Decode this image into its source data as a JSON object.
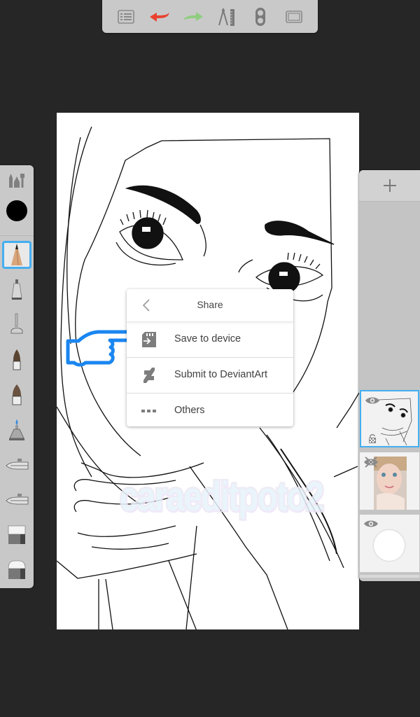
{
  "toolbar": {
    "buttons": [
      {
        "name": "layers-list",
        "icon": "list-icon"
      },
      {
        "name": "undo",
        "icon": "undo-arrow-icon",
        "color": "#e8432f"
      },
      {
        "name": "redo",
        "icon": "redo-arrow-icon",
        "color": "#8fcd7f"
      },
      {
        "name": "guides",
        "icon": "compass-ruler-icon"
      },
      {
        "name": "symmetry",
        "icon": "symmetry-icon"
      },
      {
        "name": "fullscreen",
        "icon": "fullscreen-icon"
      }
    ]
  },
  "palette": {
    "current_color": "#000000",
    "selected_accent": "#45aef0",
    "tools": [
      {
        "name": "pencil",
        "selected": true
      },
      {
        "name": "ballpoint-pen",
        "selected": false
      },
      {
        "name": "marker",
        "selected": false
      },
      {
        "name": "brush",
        "selected": false
      },
      {
        "name": "paint-brush",
        "selected": false
      },
      {
        "name": "fill-marker",
        "selected": false
      },
      {
        "name": "airbrush",
        "selected": false
      },
      {
        "name": "airbrush-alt",
        "selected": false
      },
      {
        "name": "hard-eraser",
        "selected": false
      },
      {
        "name": "soft-eraser",
        "selected": false
      }
    ]
  },
  "canvas": {
    "watermark": "caraeditpoto2"
  },
  "share_menu": {
    "title": "Share",
    "items": [
      {
        "label": "Save to device",
        "icon": "sd-card-save-icon"
      },
      {
        "label": "Submit to DeviantArt",
        "icon": "deviantart-icon"
      },
      {
        "label": "Others",
        "icon": "more-dots-icon"
      }
    ]
  },
  "layers": {
    "add_label": "+",
    "items": [
      {
        "name": "line-art-layer",
        "visible": true,
        "locked": true,
        "selected": true
      },
      {
        "name": "photo-layer",
        "visible": false,
        "locked": false,
        "selected": false
      },
      {
        "name": "background-layer",
        "visible": true,
        "locked": false,
        "selected": false
      }
    ]
  }
}
